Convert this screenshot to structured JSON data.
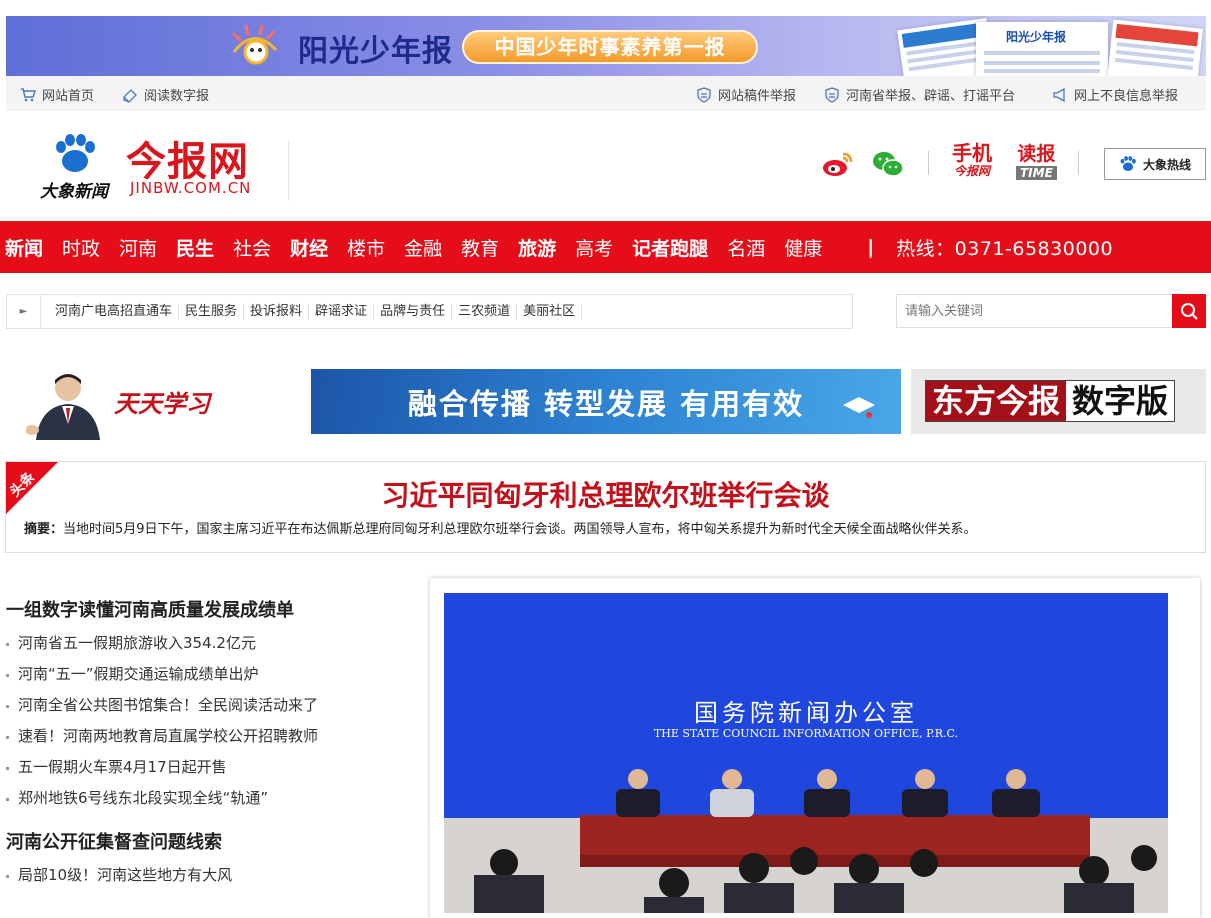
{
  "banner": {
    "brand": "阳光少年报",
    "slogan": "中国少年时事素养第一报",
    "paper_title": "阳光少年报"
  },
  "utility": {
    "home": "网站首页",
    "epaper": "阅读数字报",
    "report_manuscript": "网站稿件举报",
    "henan_report": "河南省举报、辟谣、打谣平台",
    "bad_info": "网上不良信息举报"
  },
  "header": {
    "parent_brand": "大象新闻",
    "site_name": "今报网",
    "site_url": "JINBW.COM.CN",
    "app_mobile_top": "手机",
    "app_mobile_bottom": "今报网",
    "app_read_top": "读报",
    "app_read_bottom": "TIME",
    "hotline_button": "大象热线"
  },
  "nav": {
    "items": [
      {
        "label": "新闻",
        "bold": true
      },
      {
        "label": "时政",
        "bold": false
      },
      {
        "label": "河南",
        "bold": false
      },
      {
        "label": "民生",
        "bold": true
      },
      {
        "label": "社会",
        "bold": false
      },
      {
        "label": "财经",
        "bold": true
      },
      {
        "label": "楼市",
        "bold": false
      },
      {
        "label": "金融",
        "bold": false
      },
      {
        "label": "教育",
        "bold": false
      },
      {
        "label": "旅游",
        "bold": true
      },
      {
        "label": "高考",
        "bold": false
      },
      {
        "label": "记者跑腿",
        "bold": true
      },
      {
        "label": "名酒",
        "bold": false
      },
      {
        "label": "健康",
        "bold": false
      }
    ],
    "divider": "|",
    "hotline": "热线：0371-65830000"
  },
  "subnav": {
    "items": [
      "河南广电高招直通车",
      "民生服务",
      "投诉报料",
      "辟谣求证",
      "品牌与责任",
      "三农频道",
      "美丽社区"
    ]
  },
  "search": {
    "placeholder": "请输入关键词"
  },
  "promo": {
    "study_slogan": "天天学习",
    "blue_slogan": "融合传播  转型发展  有用有效",
    "digital_left": "东方今报",
    "digital_right": "数字版"
  },
  "headline": {
    "corner_label": "头条",
    "title": "习近平同匈牙利总理欧尔班举行会谈",
    "summary_label": "摘要：",
    "summary": "当地时间5月9日下午，国家主席习近平在布达佩斯总理府同匈牙利总理欧尔班举行会谈。两国领导人宣布，将中匈关系提升为新时代全天候全面战略伙伴关系。"
  },
  "news": {
    "section1_title": "一组数字读懂河南高质量发展成绩单",
    "section1_items": [
      "河南省五一假期旅游收入354.2亿元",
      "河南“五一”假期交通运输成绩单出炉",
      "河南全省公共图书馆集合！全民阅读活动来了",
      "速看！河南两地教育局直属学校公开招聘教师",
      "五一假期火车票4月17日起开售",
      "郑州地铁6号线东北段实现全线“轨通”"
    ],
    "section2_title": "河南公开征集督查问题线索",
    "section2_items": [
      "局部10级！河南这些地方有大风"
    ]
  },
  "photo": {
    "org_cn": "国务院新闻办公室",
    "org_en": "THE STATE COUNCIL INFORMATION OFFICE, P.R.C."
  },
  "colors": {
    "brand_red": "#e60d1a",
    "headline_red": "#c2111a",
    "slogan_blue": "#2d82d2"
  }
}
